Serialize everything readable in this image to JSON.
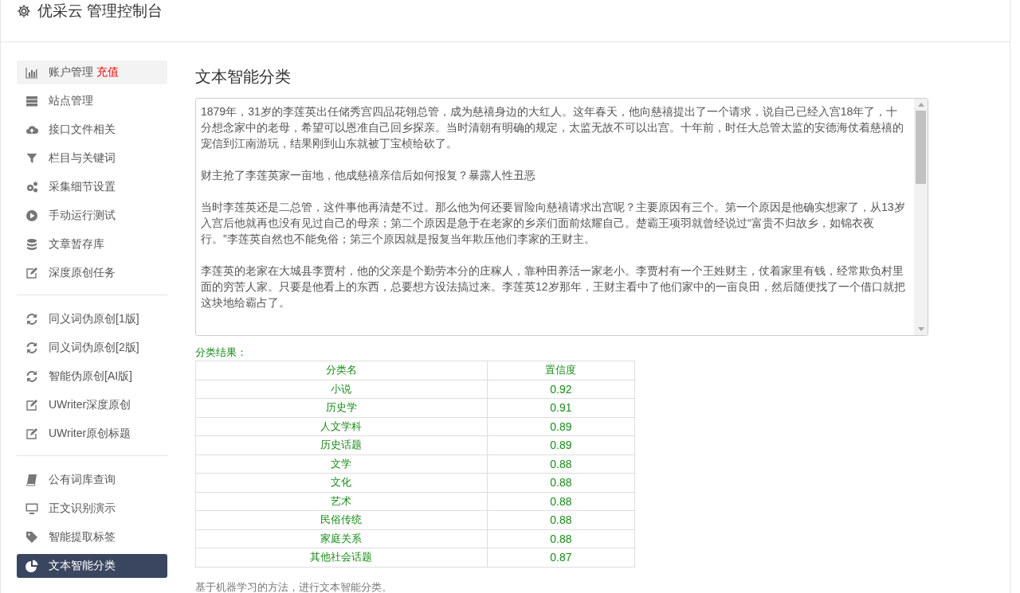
{
  "header": {
    "title": "优采云 管理控制台"
  },
  "sidebar": {
    "groups": [
      {
        "items": [
          {
            "label": "账户管理",
            "badge": "充值",
            "hovered": true,
            "selected": false
          },
          {
            "label": "站点管理",
            "hovered": false,
            "selected": false
          },
          {
            "label": "接口文件相关",
            "hovered": false,
            "selected": false
          },
          {
            "label": "栏目与关键词",
            "hovered": false,
            "selected": false
          },
          {
            "label": "采集细节设置",
            "hovered": false,
            "selected": false
          },
          {
            "label": "手动运行测试",
            "hovered": false,
            "selected": false
          },
          {
            "label": "文章暂存库",
            "hovered": false,
            "selected": false
          },
          {
            "label": "深度原创任务",
            "hovered": false,
            "selected": false
          }
        ]
      },
      {
        "items": [
          {
            "label": "同义词伪原创[1版]",
            "hovered": false,
            "selected": false
          },
          {
            "label": "同义词伪原创[2版]",
            "hovered": false,
            "selected": false
          },
          {
            "label": "智能伪原创[AI版]",
            "hovered": false,
            "selected": false
          },
          {
            "label": "UWriter深度原创",
            "hovered": false,
            "selected": false
          },
          {
            "label": "UWriter原创标题",
            "hovered": false,
            "selected": false
          }
        ]
      },
      {
        "items": [
          {
            "label": "公有词库查询",
            "hovered": false,
            "selected": false
          },
          {
            "label": "正文识别演示",
            "hovered": false,
            "selected": false
          },
          {
            "label": "智能提取标签",
            "hovered": false,
            "selected": false
          },
          {
            "label": "文本智能分类",
            "hovered": false,
            "selected": true
          }
        ]
      }
    ]
  },
  "main": {
    "title": "文本智能分类",
    "paragraphs": [
      "1879年，31岁的李莲英出任储秀宫四品花翎总管，成为慈禧身边的大红人。这年春天，他向慈禧提出了一个请求，说自己已经入宫18年了，十分想念家中的老母，希望可以恩准自己回乡探亲。当时清朝有明确的规定，太监无故不可以出宫。十年前，时任大总管太监的安德海仗着慈禧的宠信到江南游玩，结果刚到山东就被丁宝桢给砍了。",
      "财主抢了李莲英家一亩地，他成慈禧亲信后如何报复？暴露人性丑恶",
      "当时李莲英还是二总管，这件事他再清楚不过。那么他为何还要冒险向慈禧请求出宫呢？主要原因有三个。第一个原因是他确实想家了，从13岁入宫后他就再也没有见过自己的母亲；第二个原因是急于在老家的乡亲们面前炫耀自己。楚霸王项羽就曾经说过“富贵不归故乡，如锦衣夜行。”李莲英自然也不能免俗；第三个原因就是报复当年欺压他们李家的王财主。",
      "李莲英的老家在大城县李贾村，他的父亲是个勤劳本分的庄稼人，靠种田养活一家老小。李贾村有一个王姓财主，仗着家里有钱，经常欺负村里面的穷苦人家。只要是他看上的东西，总要想方设法搞过来。李莲英12岁那年，王财主看中了他们家中的一亩良田，然后随便找了一个借口就把这块地给霸占了。"
    ],
    "result_label": "分类结果：",
    "table": {
      "columns": [
        "分类名",
        "置信度"
      ],
      "rows": [
        [
          "小说",
          "0.92"
        ],
        [
          "历史学",
          "0.91"
        ],
        [
          "人文学科",
          "0.89"
        ],
        [
          "历史话题",
          "0.89"
        ],
        [
          "文学",
          "0.88"
        ],
        [
          "文化",
          "0.88"
        ],
        [
          "艺术",
          "0.88"
        ],
        [
          "民俗传统",
          "0.88"
        ],
        [
          "家庭关系",
          "0.88"
        ],
        [
          "其他社会话题",
          "0.87"
        ]
      ]
    },
    "note": "基于机器学习的方法，进行文本智能分类。"
  }
}
